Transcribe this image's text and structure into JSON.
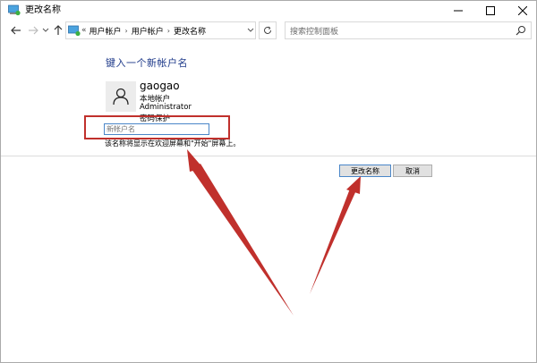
{
  "window": {
    "title": "更改名称",
    "icons": {
      "app": "control-panel-icon",
      "minimize": "minimize-icon",
      "maximize": "maximize-icon",
      "close": "close-icon"
    }
  },
  "nav": {
    "lead": "«",
    "breadcrumbs": [
      "用户帐户",
      "用户帐户",
      "更改名称"
    ],
    "search_placeholder": "搜索控制面板"
  },
  "content": {
    "heading": "键入一个新帐户名",
    "account": {
      "username": "gaogao",
      "type": "本地帐户",
      "role": "Administrator",
      "password_status": "密码保护"
    },
    "new_name_placeholder": "新帐户名",
    "hint": "该名称将显示在欢迎屏幕和\"开始\"屏幕上。"
  },
  "buttons": {
    "rename": "更改名称",
    "cancel": "取消"
  },
  "colors": {
    "heading": "#1e3a8a",
    "annotation": "#c0302c",
    "focus_border": "#4a86c8"
  }
}
